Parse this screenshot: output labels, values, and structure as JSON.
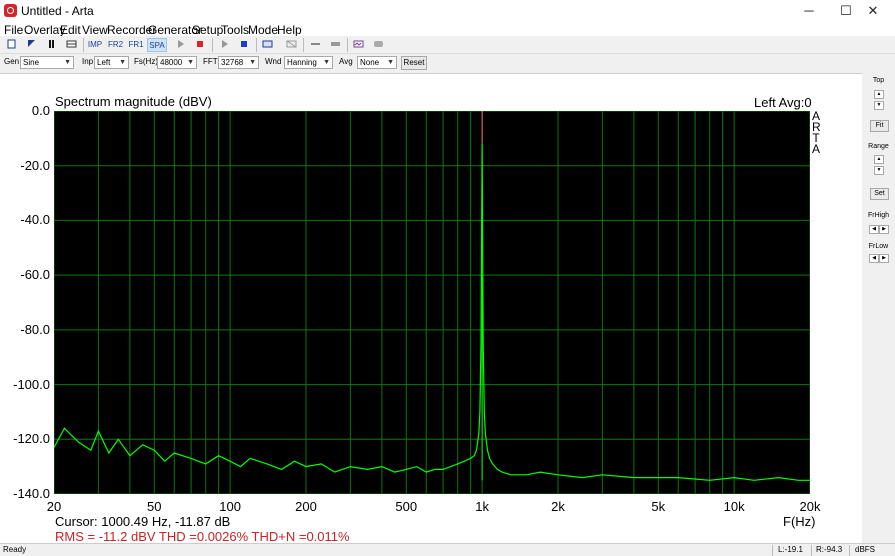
{
  "window": {
    "title": "Untitled - Arta",
    "minimize": "─",
    "maximize": "☐",
    "close": "✕"
  },
  "menu": [
    "File",
    "Overlay",
    "Edit",
    "View",
    "Recorder",
    "Generator",
    "Setup",
    "Tools",
    "Mode",
    "Help"
  ],
  "toolbar": {
    "imp": "IMP",
    "fr2": "FR2",
    "fr1": "FR1",
    "spa": "SPA",
    "spa_active": true
  },
  "controls": {
    "gen_label": "Gen",
    "gen_value": "Sine",
    "inp_label": "Inp",
    "inp_value": "Left",
    "fs_label": "Fs(Hz)",
    "fs_value": "48000",
    "fft_label": "FFT",
    "fft_value": "32768",
    "wnd_label": "Wnd",
    "wnd_value": "Hanning",
    "avg_label": "Avg",
    "avg_value": "None",
    "reset_label": "Reset"
  },
  "plot": {
    "title": "Spectrum magnitude (dBV)",
    "channel": "Left  Avg:0",
    "watermark": [
      "A",
      "R",
      "T",
      "A"
    ],
    "xunit": "F(Hz)",
    "cursor": "Cursor: 1000.49 Hz, -11.87 dB",
    "stats": "RMS =  -11.2 dBV  THD =0.0026%  THD+N =0.011%"
  },
  "sidebar": {
    "top_label": "Top",
    "fit_label": "Fit",
    "range_label": "Range",
    "set_label": "Set",
    "frhigh_label": "FrHigh",
    "frlow_label": "FrLow",
    "up": "▲",
    "down": "▼",
    "left": "◀",
    "right": "▶"
  },
  "status": {
    "ready": "Ready",
    "level_l": "L:-19.1",
    "level_r": "R:-94.3",
    "unit": "dBFS"
  },
  "colors": {
    "plot_bg": "#000000",
    "grid": "#0b7a0b",
    "trace": "#00ff00",
    "fundamental": "#ff6666",
    "stats_text": "#cc2222"
  },
  "chart_data": {
    "type": "line",
    "title": "Spectrum magnitude (dBV)",
    "xlabel": "F(Hz)",
    "ylabel": "",
    "x_scale": "log",
    "xlim": [
      20,
      20000
    ],
    "ylim": [
      -140,
      0
    ],
    "grid": true,
    "x_tick_labels": [
      "20",
      "50",
      "100",
      "200",
      "500",
      "1k",
      "2k",
      "5k",
      "10k",
      "20k"
    ],
    "x_tick_values": [
      20,
      50,
      100,
      200,
      500,
      1000,
      2000,
      5000,
      10000,
      20000
    ],
    "y_tick_labels": [
      "0.0",
      "-20.0",
      "-40.0",
      "-60.0",
      "-80.0",
      "-100.0",
      "-120.0",
      "-140.0"
    ],
    "y_tick_values": [
      0,
      -20,
      -40,
      -60,
      -80,
      -100,
      -120,
      -140
    ],
    "series": [
      {
        "name": "Left",
        "x": [
          20,
          22,
          25,
          28,
          30,
          33,
          36,
          40,
          45,
          50,
          55,
          60,
          70,
          80,
          90,
          100,
          110,
          120,
          140,
          160,
          180,
          200,
          230,
          260,
          300,
          350,
          400,
          450,
          500,
          550,
          600,
          650,
          700,
          750,
          800,
          850,
          900,
          930,
          950,
          970,
          980,
          990,
          1000,
          1010,
          1020,
          1030,
          1050,
          1070,
          1100,
          1150,
          1200,
          1300,
          1500,
          1700,
          2000,
          2500,
          3000,
          4000,
          5000,
          6000,
          8000,
          10000,
          12000,
          15000,
          18000,
          20000
        ],
        "y": [
          -123,
          -116,
          -121,
          -124,
          -117,
          -125,
          -120,
          -126,
          -122,
          -124,
          -128,
          -125,
          -127,
          -129,
          -126,
          -128,
          -130,
          -127,
          -129,
          -131,
          -128,
          -130,
          -129,
          -132,
          -130,
          -131,
          -130,
          -132,
          -131,
          -130,
          -132,
          -131,
          -131,
          -130,
          -129,
          -128,
          -127,
          -126,
          -124,
          -118,
          -110,
          -85,
          -11.87,
          -85,
          -110,
          -118,
          -124,
          -127,
          -129,
          -131,
          -132,
          -133,
          -133,
          -132,
          -133,
          -134,
          -133,
          -134,
          -134,
          -134,
          -135,
          -134,
          -135,
          -134,
          -135,
          -135
        ]
      }
    ],
    "harmonics": [
      {
        "x": 1000,
        "y": -60
      }
    ]
  }
}
